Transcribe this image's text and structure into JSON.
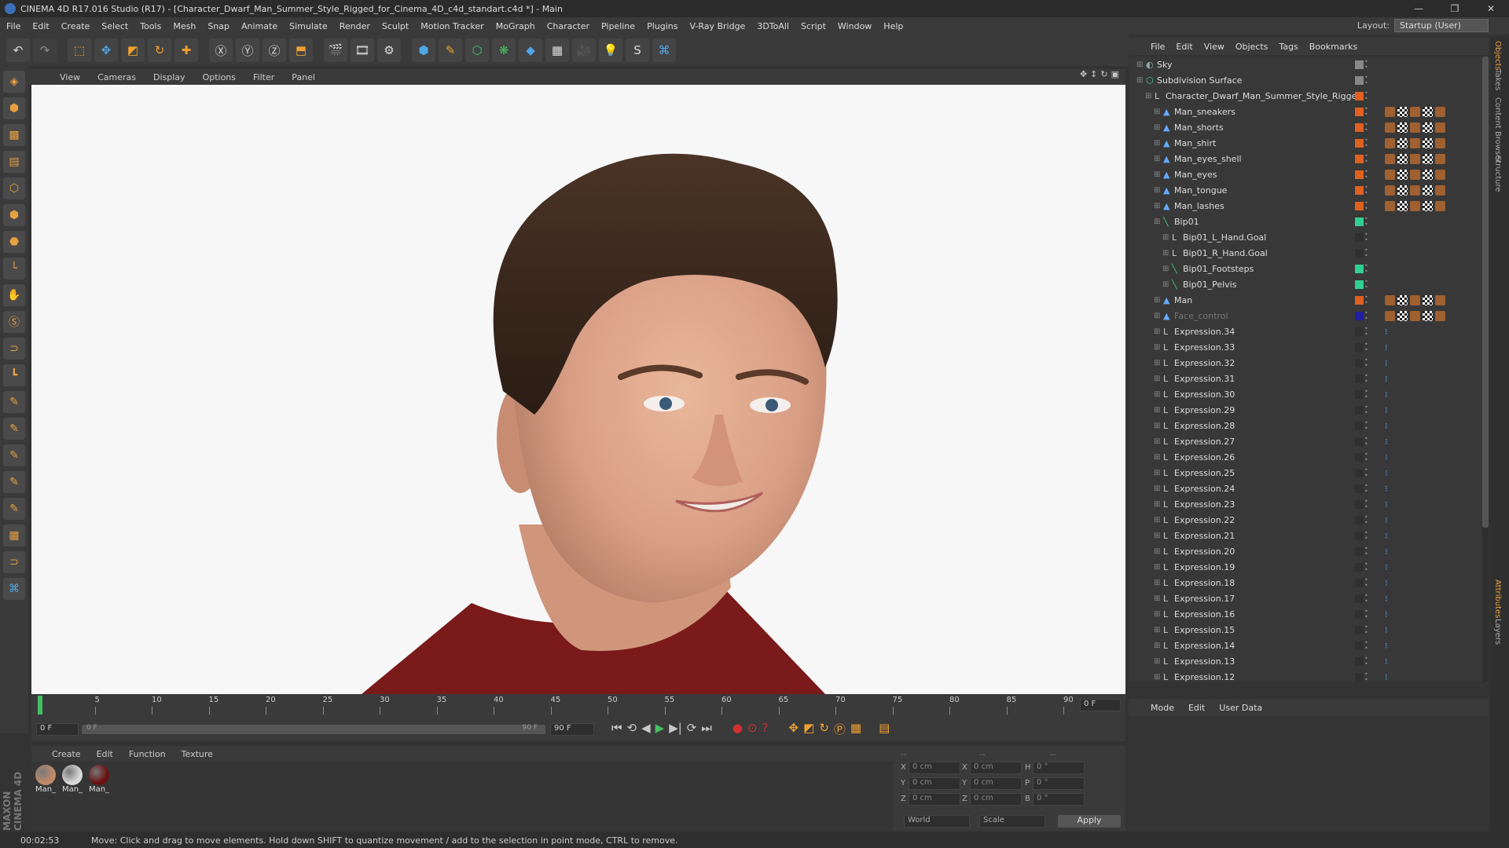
{
  "window": {
    "title": "CINEMA 4D R17.016 Studio (R17) - [Character_Dwarf_Man_Summer_Style_Rigged_for_Cinema_4D_c4d_standart.c4d *] - Main"
  },
  "menubar": {
    "items": [
      "File",
      "Edit",
      "Create",
      "Select",
      "Tools",
      "Mesh",
      "Snap",
      "Animate",
      "Simulate",
      "Render",
      "Sculpt",
      "Motion Tracker",
      "MoGraph",
      "Character",
      "Pipeline",
      "Plugins",
      "V-Ray Bridge",
      "3DToAll",
      "Script",
      "Window",
      "Help"
    ],
    "layout_label": "Layout:",
    "layout_value": "Startup (User)"
  },
  "viewport": {
    "menu": [
      "View",
      "Cameras",
      "Display",
      "Options",
      "Filter",
      "Panel"
    ]
  },
  "timeline": {
    "ticks": [
      "0",
      "5",
      "10",
      "15",
      "20",
      "25",
      "30",
      "35",
      "40",
      "45",
      "50",
      "55",
      "60",
      "65",
      "70",
      "75",
      "80",
      "85",
      "90"
    ],
    "current_frame": "0 F",
    "start_field": "0 F",
    "range_start": "0 F",
    "range_end": "90 F",
    "end_field": "90 F"
  },
  "materials": {
    "menu": [
      "Create",
      "Edit",
      "Function",
      "Texture"
    ],
    "items": [
      {
        "label": "Man_",
        "color": "#c08a6a"
      },
      {
        "label": "Man_",
        "color": "#d8d8d8"
      },
      {
        "label": "Man_",
        "color": "#6a1010"
      }
    ]
  },
  "coords": {
    "rows": [
      {
        "a": "X",
        "av": "0 cm",
        "b": "X",
        "bv": "0 cm",
        "c": "H",
        "cv": "0 °"
      },
      {
        "a": "Y",
        "av": "0 cm",
        "b": "Y",
        "bv": "0 cm",
        "c": "P",
        "cv": "0 °"
      },
      {
        "a": "Z",
        "av": "0 cm",
        "b": "Z",
        "bv": "0 cm",
        "c": "B",
        "cv": "0 °"
      }
    ],
    "world": "World",
    "scale": "Scale",
    "apply": "Apply",
    "header_a": "--",
    "header_b": "--",
    "header_c": "--"
  },
  "objects": {
    "menu": [
      "File",
      "Edit",
      "View",
      "Objects",
      "Tags",
      "Bookmarks"
    ],
    "rows": [
      {
        "name": "Sky",
        "indent": 0,
        "color": "#888888",
        "icon": "sky"
      },
      {
        "name": "Subdivision Surface",
        "indent": 0,
        "color": "#888888",
        "icon": "subd"
      },
      {
        "name": "Character_Dwarf_Man_Summer_Style_Rigged",
        "indent": 1,
        "color": "#e06020",
        "icon": "null"
      },
      {
        "name": "Man_sneakers",
        "indent": 2,
        "color": "#e06020",
        "icon": "mesh"
      },
      {
        "name": "Man_shorts",
        "indent": 2,
        "color": "#e06020",
        "icon": "mesh"
      },
      {
        "name": "Man_shirt",
        "indent": 2,
        "color": "#e06020",
        "icon": "mesh"
      },
      {
        "name": "Man_eyes_shell",
        "indent": 2,
        "color": "#e06020",
        "icon": "mesh"
      },
      {
        "name": "Man_eyes",
        "indent": 2,
        "color": "#e06020",
        "icon": "mesh"
      },
      {
        "name": "Man_tongue",
        "indent": 2,
        "color": "#e06020",
        "icon": "mesh"
      },
      {
        "name": "Man_lashes",
        "indent": 2,
        "color": "#e06020",
        "icon": "mesh"
      },
      {
        "name": "Bip01",
        "indent": 2,
        "color": "#30d090",
        "icon": "bone"
      },
      {
        "name": "Bip01_L_Hand.Goal",
        "indent": 3,
        "color": "#303030",
        "icon": "null"
      },
      {
        "name": "Bip01_R_Hand.Goal",
        "indent": 3,
        "color": "#303030",
        "icon": "null"
      },
      {
        "name": "Bip01_Footsteps",
        "indent": 3,
        "color": "#30d090",
        "icon": "bone"
      },
      {
        "name": "Bip01_Pelvis",
        "indent": 3,
        "color": "#30d090",
        "icon": "bone"
      },
      {
        "name": "Man",
        "indent": 2,
        "color": "#e06020",
        "icon": "mesh"
      },
      {
        "name": "Face_control",
        "indent": 2,
        "color": "#2020a0",
        "icon": "mesh"
      },
      {
        "name": "Expression.34",
        "indent": 2,
        "color": "#303030",
        "icon": "null"
      },
      {
        "name": "Expression.33",
        "indent": 2,
        "color": "#303030",
        "icon": "null"
      },
      {
        "name": "Expression.32",
        "indent": 2,
        "color": "#303030",
        "icon": "null"
      },
      {
        "name": "Expression.31",
        "indent": 2,
        "color": "#303030",
        "icon": "null"
      },
      {
        "name": "Expression.30",
        "indent": 2,
        "color": "#303030",
        "icon": "null"
      },
      {
        "name": "Expression.29",
        "indent": 2,
        "color": "#303030",
        "icon": "null"
      },
      {
        "name": "Expression.28",
        "indent": 2,
        "color": "#303030",
        "icon": "null"
      },
      {
        "name": "Expression.27",
        "indent": 2,
        "color": "#303030",
        "icon": "null"
      },
      {
        "name": "Expression.26",
        "indent": 2,
        "color": "#303030",
        "icon": "null"
      },
      {
        "name": "Expression.25",
        "indent": 2,
        "color": "#303030",
        "icon": "null"
      },
      {
        "name": "Expression.24",
        "indent": 2,
        "color": "#303030",
        "icon": "null"
      },
      {
        "name": "Expression.23",
        "indent": 2,
        "color": "#303030",
        "icon": "null"
      },
      {
        "name": "Expression.22",
        "indent": 2,
        "color": "#303030",
        "icon": "null"
      },
      {
        "name": "Expression.21",
        "indent": 2,
        "color": "#303030",
        "icon": "null"
      },
      {
        "name": "Expression.20",
        "indent": 2,
        "color": "#303030",
        "icon": "null"
      },
      {
        "name": "Expression.19",
        "indent": 2,
        "color": "#303030",
        "icon": "null"
      },
      {
        "name": "Expression.18",
        "indent": 2,
        "color": "#303030",
        "icon": "null"
      },
      {
        "name": "Expression.17",
        "indent": 2,
        "color": "#303030",
        "icon": "null"
      },
      {
        "name": "Expression.16",
        "indent": 2,
        "color": "#303030",
        "icon": "null"
      },
      {
        "name": "Expression.15",
        "indent": 2,
        "color": "#303030",
        "icon": "null"
      },
      {
        "name": "Expression.14",
        "indent": 2,
        "color": "#303030",
        "icon": "null"
      },
      {
        "name": "Expression.13",
        "indent": 2,
        "color": "#303030",
        "icon": "null"
      },
      {
        "name": "Expression.12",
        "indent": 2,
        "color": "#303030",
        "icon": "null"
      }
    ]
  },
  "attributes": {
    "menu": [
      "Mode",
      "Edit",
      "User Data"
    ]
  },
  "right_tabs": [
    "Objects",
    "Takes",
    "Content Browser",
    "Structure",
    "Attributes",
    "Layers"
  ],
  "status": {
    "time": "00:02:53",
    "message": "Move: Click and drag to move elements. Hold down SHIFT to quantize movement / add to the selection in point mode, CTRL to remove."
  },
  "branding": {
    "logo": "MAXON CINEMA 4D"
  }
}
